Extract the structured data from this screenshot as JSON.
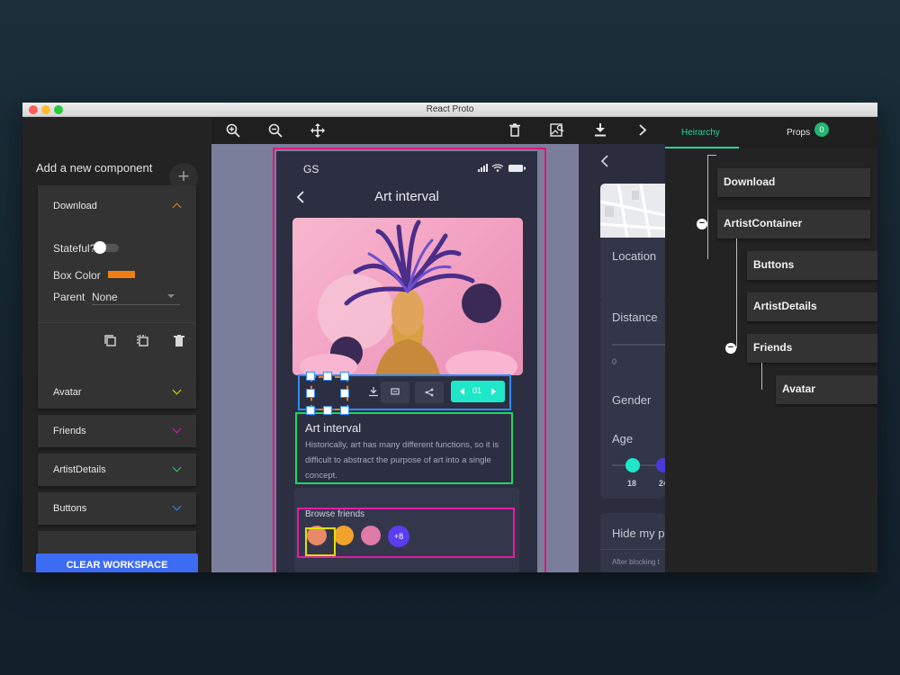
{
  "window": {
    "title": "React Proto"
  },
  "left_panel": {
    "add_label": "Add a new component",
    "add_button": "+",
    "download_card": {
      "label": "Download",
      "accent": "#f07d14",
      "stateful_label": "Stateful?",
      "box_color_label": "Box Color",
      "box_color": "#f07d14",
      "parent_label": "Parent",
      "parent_value": "None"
    },
    "cards": [
      {
        "label": "Avatar",
        "accent": "#e2e000"
      },
      {
        "label": "Friends",
        "accent": "#e21ca6"
      },
      {
        "label": "ArtistDetails",
        "accent": "#1ed760"
      },
      {
        "label": "Buttons",
        "accent": "#2f8cff"
      }
    ],
    "clear_button": "CLEAR WORKSPACE"
  },
  "phone": {
    "brand": "GS",
    "title": "Art interval",
    "page_value": "01",
    "info_title": "Art interval",
    "info_body": "Historically, art has many different functions, so it is difficult to abstract the purpose of art into a single concept.",
    "friends_label": "Browse friends",
    "friends_more": "+8"
  },
  "preview": {
    "location": "Location",
    "distance": "Distance",
    "distance_value": "0",
    "gender": "Gender",
    "age": "Age",
    "age_min": "18",
    "age_max": "24",
    "hide": "Hide my p",
    "after": "After blocking t"
  },
  "right_panel": {
    "tabs": {
      "hierarchy": "Heirarchy",
      "props": "Props"
    },
    "props_badge": "0",
    "tree": {
      "download": "Download",
      "artist_container": "ArtistContainer",
      "buttons": "Buttons",
      "artist_details": "ArtistDetails",
      "friends": "Friends",
      "avatar": "Avatar"
    },
    "collapse_symbol": "−"
  }
}
